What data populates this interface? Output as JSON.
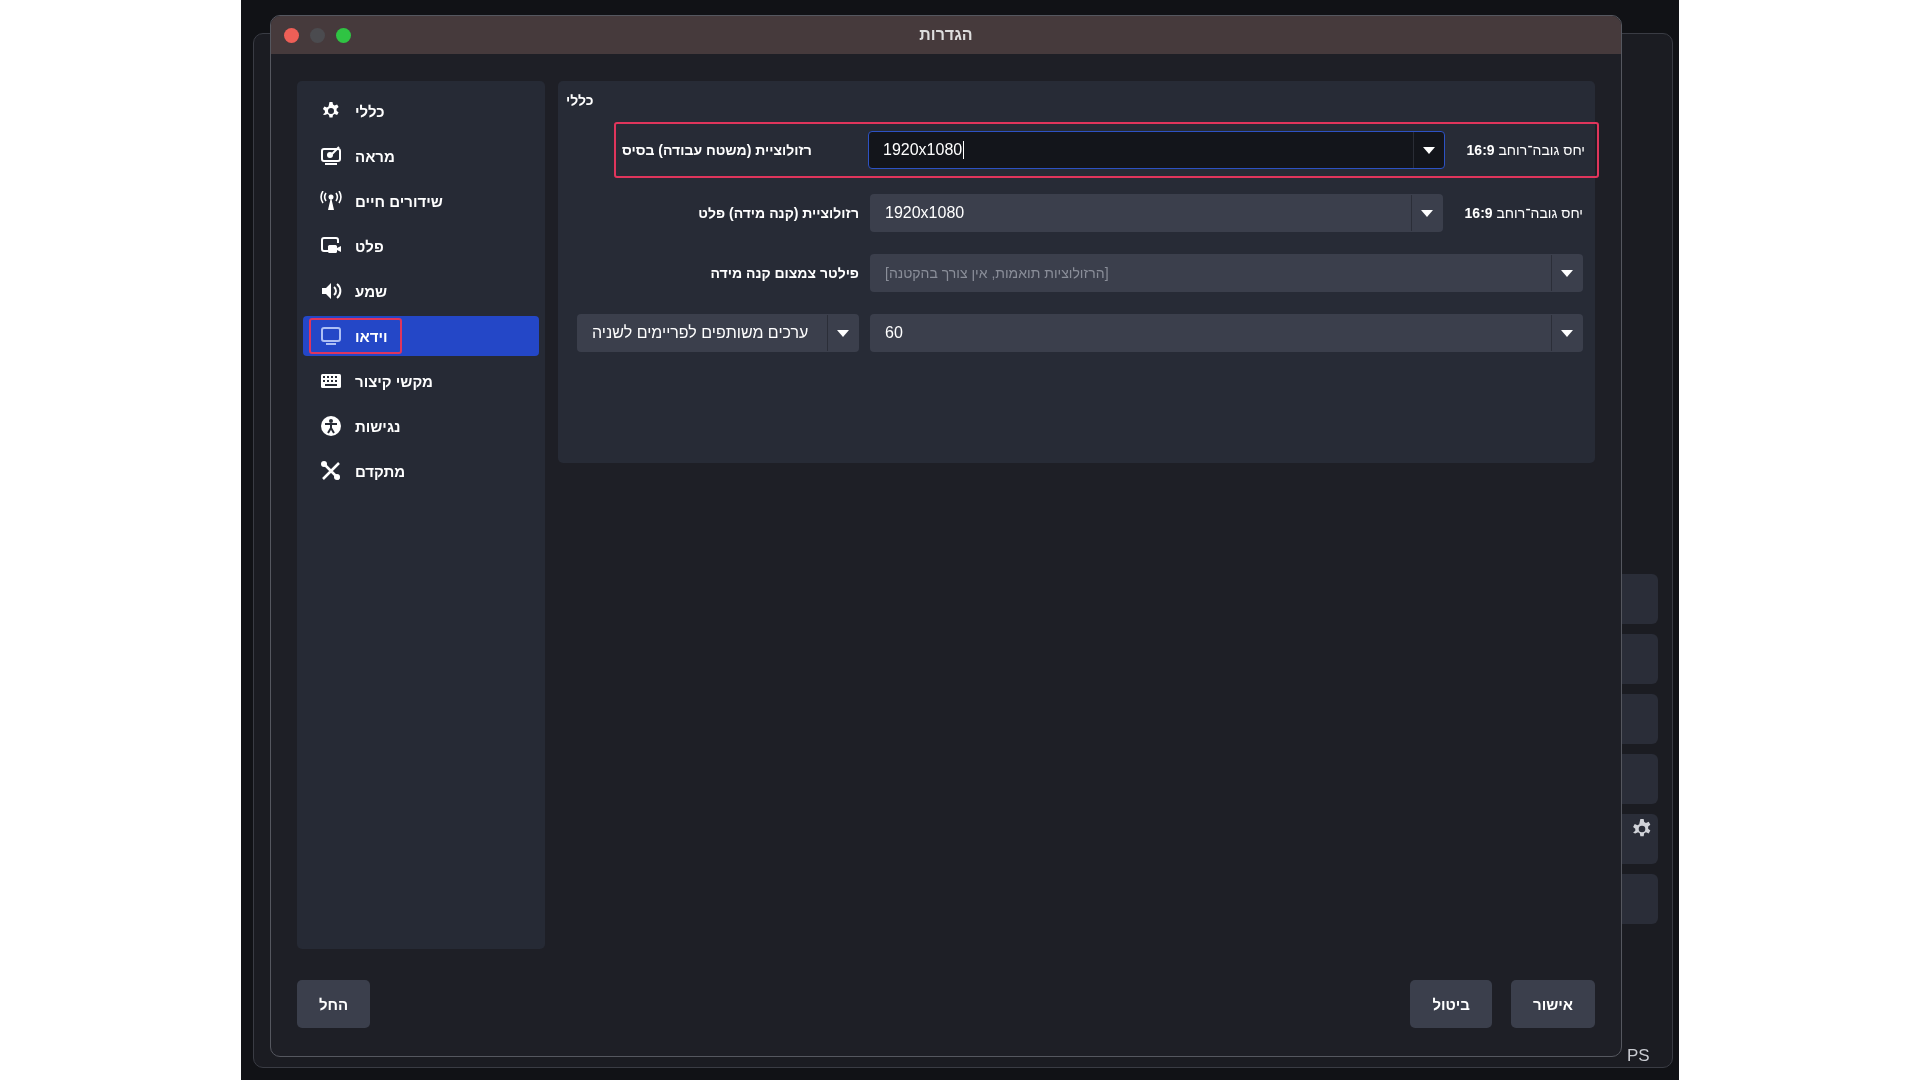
{
  "window": {
    "title": "הגדרות"
  },
  "sidebar": {
    "items": [
      {
        "label": "כללי",
        "kind": "gear",
        "selected": false,
        "highlighted": false
      },
      {
        "label": "מראה",
        "kind": "appearance",
        "selected": false,
        "highlighted": false
      },
      {
        "label": "שידורים חיים",
        "kind": "antenna",
        "selected": false,
        "highlighted": false
      },
      {
        "label": "פלט",
        "kind": "output",
        "selected": false,
        "highlighted": false
      },
      {
        "label": "שמע",
        "kind": "speaker",
        "selected": false,
        "highlighted": false
      },
      {
        "label": "וידאו",
        "kind": "monitor",
        "selected": true,
        "highlighted": true
      },
      {
        "label": "מקשי קיצור",
        "kind": "keyboard",
        "selected": false,
        "highlighted": false
      },
      {
        "label": "נגישות",
        "kind": "accessibility",
        "selected": false,
        "highlighted": false
      },
      {
        "label": "מתקדם",
        "kind": "tools",
        "selected": false,
        "highlighted": false
      }
    ]
  },
  "section": {
    "title": "כללי",
    "rows": [
      {
        "kind": "resolution",
        "label": "רזולוציית (משטח עבודה) בסיס",
        "value": "1920x1080",
        "focused": true,
        "disabled": false,
        "highlighted": true,
        "ratio": "יחס גובה־רוחב **16:9**"
      },
      {
        "kind": "resolution",
        "label": "רזולוציית (קנה מידה) פלט",
        "value": "1920x1080",
        "focused": false,
        "disabled": false,
        "highlighted": false,
        "ratio": "יחס גובה־רוחב **16:9**"
      },
      {
        "kind": "select",
        "label": "פילטר צמצום קנה מידה",
        "value": "[הרזולוציות תואמות, אין צורך בהקטנה]",
        "focused": false,
        "disabled": true,
        "highlighted": false
      },
      {
        "kind": "fps",
        "label": "ערכים משותפים לפריימים לשניה",
        "value": "60",
        "focused": false,
        "disabled": false,
        "highlighted": false
      }
    ]
  },
  "buttons": [
    {
      "kind": "ok",
      "label": "אישור"
    },
    {
      "kind": "cancel",
      "label": "ביטול"
    },
    {
      "kind": "apply",
      "label": "החל"
    }
  ],
  "background_window": {
    "status_text": "PS"
  }
}
